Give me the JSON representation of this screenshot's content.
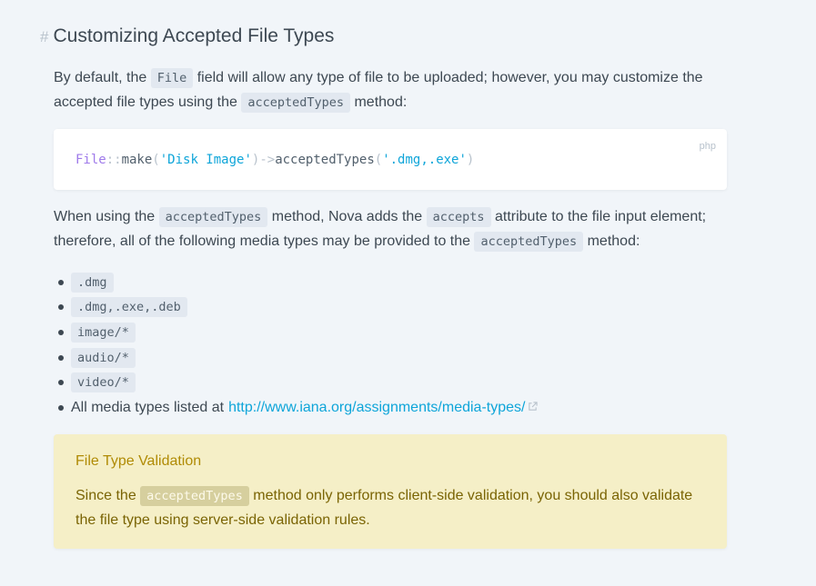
{
  "heading": {
    "hash": "#",
    "title": "Customizing Accepted File Types"
  },
  "intro": {
    "t1": "By default, the ",
    "c1": "File",
    "t2": " field will allow any type of file to be uploaded; however, you may customize the accepted file types using the ",
    "c2": "acceptedTypes",
    "t3": " method:"
  },
  "code_block": {
    "language": "php",
    "tokens": {
      "cls": "File",
      "dc": "::",
      "make": "make",
      "p1": "(",
      "arg1": "'Disk Image'",
      "p2": ")",
      "arrow": "->",
      "method": "acceptedTypes",
      "p3": "(",
      "arg2": "'.dmg,.exe'",
      "p4": ")"
    }
  },
  "usage": {
    "t1": "When using the ",
    "c1": "acceptedTypes",
    "t2": " method, Nova adds the ",
    "c2": "accepts",
    "t3": " attribute to the file input element; therefore, all of the following media types may be provided to the ",
    "c3": "acceptedTypes",
    "t4": " method:"
  },
  "media_types": [
    ".dmg",
    ".dmg,.exe,.deb",
    "image/*",
    "audio/*",
    "video/*"
  ],
  "iana": {
    "text": "All media types listed at ",
    "link": "http://www.iana.org/assignments/media-types/",
    "icon": "external-link-icon"
  },
  "note": {
    "title": "File Type Validation",
    "t1": "Since the ",
    "c1": "acceptedTypes",
    "t2": " method only performs client-side validation, you should also validate the file type using server-side validation rules."
  },
  "colors": {
    "background": "#f1f5f9",
    "text": "#3d4852",
    "link": "#0ea5d9",
    "note_bg": "#f5efc7",
    "note_title": "#b08b05"
  }
}
